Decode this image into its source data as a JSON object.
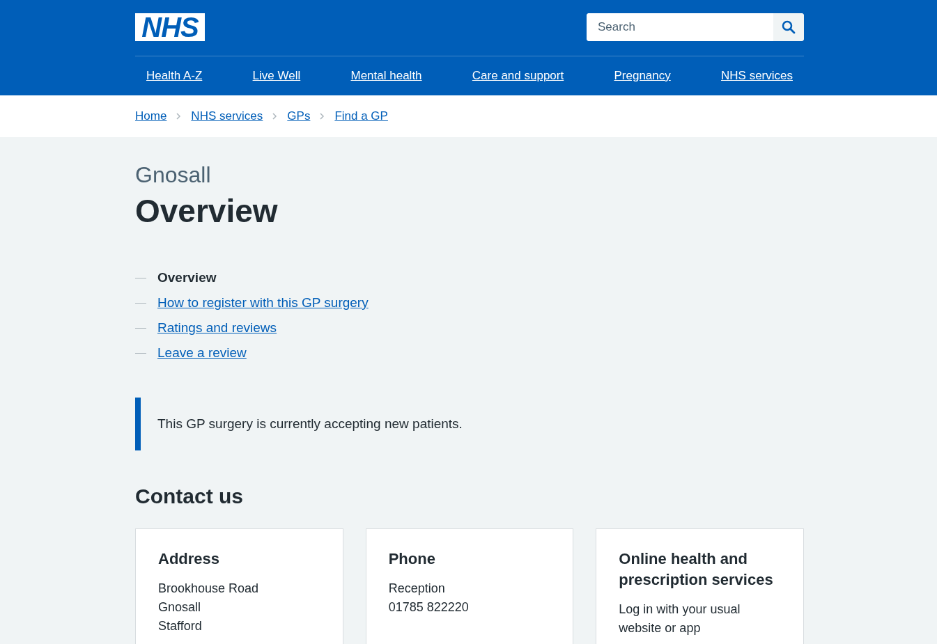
{
  "header": {
    "logo": "NHS",
    "search": {
      "placeholder": "Search"
    },
    "nav": [
      "Health A-Z",
      "Live Well",
      "Mental health",
      "Care and support",
      "Pregnancy",
      "NHS services"
    ]
  },
  "breadcrumbs": [
    "Home",
    "NHS services",
    "GPs",
    "Find a GP"
  ],
  "page": {
    "caption": "Gnosall",
    "title": "Overview",
    "contents": [
      {
        "label": "Overview",
        "selected": true
      },
      {
        "label": "How to register with this GP surgery",
        "selected": false
      },
      {
        "label": "Ratings and reviews",
        "selected": false
      },
      {
        "label": "Leave a review",
        "selected": false
      }
    ],
    "inset": "This GP surgery is currently accepting new patients.",
    "contact_heading": "Contact us",
    "cards": [
      {
        "title": "Address",
        "lines": [
          "Brookhouse Road",
          "Gnosall",
          "Stafford"
        ]
      },
      {
        "title": "Phone",
        "lines": [
          "Reception",
          "01785 822220"
        ]
      },
      {
        "title": "Online health and prescription services",
        "lines": [
          "Log in with your usual website or app"
        ]
      }
    ]
  }
}
